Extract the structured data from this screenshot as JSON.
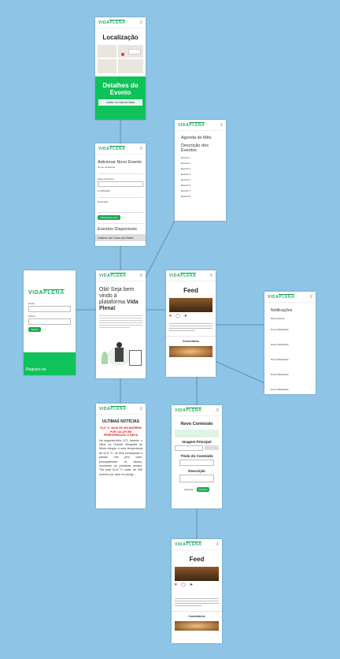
{
  "brand": {
    "part1": "VIDA",
    "part2": "PLENA",
    "accent": "#10c25a"
  },
  "icons": {
    "menu": "≡",
    "heart": "♥",
    "comment": "◯",
    "share": "➤"
  },
  "localizacao": {
    "title": "Localização",
    "details_title": "Detalhes do Evento",
    "event_button": "Xadrez na Casa da Maria"
  },
  "agenda": {
    "title": "Agenda do Mês",
    "subtitle": "Descrição dos Eventos",
    "items": [
      "Evento 1",
      "Evento 2",
      "Evento 3",
      "Evento 4",
      "Evento 5",
      "Evento 6",
      "Evento 7",
      "Evento 8"
    ]
  },
  "adicionar": {
    "title": "Adicionar Novo Evento",
    "field1": "Nome do Evento",
    "field2": "Data do Evento",
    "field3": "Localização",
    "field4": "Descrição",
    "add_button": "Adicionar Evento",
    "list_title": "Eventos Disponíveis",
    "list_item": "Xadrez na Casa da Maria"
  },
  "login": {
    "email_label": "Email",
    "password_label": "Senha",
    "submit": "Entrar",
    "register": "Registre-se"
  },
  "home": {
    "welcome_prefix": "Olá! Seja bem vindo à plataforma",
    "welcome_brand": "Vida Plena!"
  },
  "feed": {
    "title": "Feed",
    "comments": "Comentários"
  },
  "notificacoes": {
    "title": "Notificações",
    "first": "Nova Notícia",
    "items": [
      "Nova Publicação",
      "Nova Publicação",
      "Nova Publicação",
      "Nova Publicação",
      "Nova Publicação"
    ]
  },
  "noticias": {
    "title": "ULTIMAS NOTÍCIAS",
    "headline": "51,6 °C: MAIS DE 900 MORREM POR CALOR EM PEREGRINAÇÃO À MECA",
    "body": "Na segunda-feira (17), quando o clima na Grande Mesquita de Meca chegou a uma temperatura de 51,6 °C, os fiéis começaram a passar mal pelo calor, principalmente os idosos, ocorrendo as primeiras mortes. The past 51,6 °C mata, de 900 morrem por calor no peregr..."
  },
  "novo_conteudo": {
    "title": "Novo Conteúdo",
    "image_label": "Imagem Principal",
    "content_title_label": "Título do Conteúdo",
    "description_label": "Descrição",
    "cancel": "Cancelar",
    "publish": "Publicar"
  },
  "feed2": {
    "title": "Feed",
    "comments": "Comentários"
  }
}
